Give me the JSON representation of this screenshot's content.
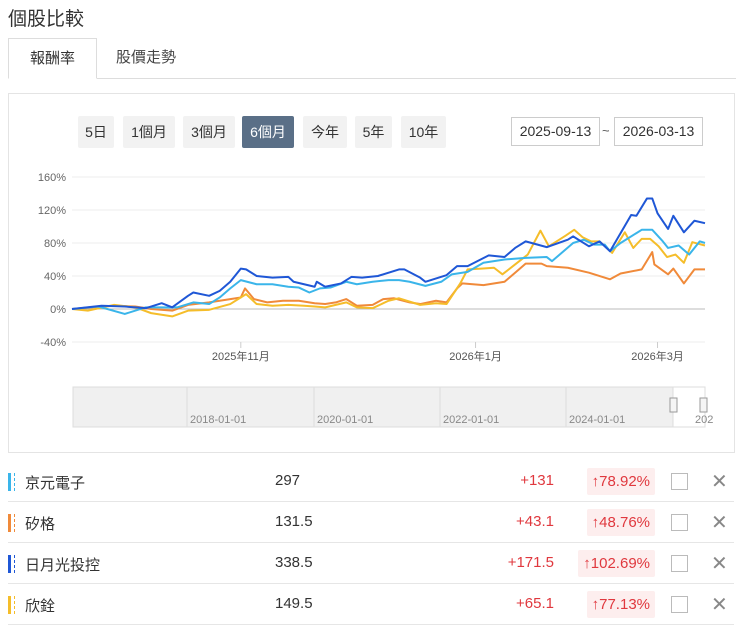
{
  "title": "個股比較",
  "tabs": [
    {
      "label": "報酬率",
      "active": true
    },
    {
      "label": "股價走勢",
      "active": false
    }
  ],
  "ranges": [
    {
      "label": "5日"
    },
    {
      "label": "1個月"
    },
    {
      "label": "3個月"
    },
    {
      "label": "6個月",
      "active": true
    },
    {
      "label": "今年"
    },
    {
      "label": "5年"
    },
    {
      "label": "10年"
    }
  ],
  "date_from": "2025-09-13",
  "date_sep": "~",
  "date_to": "2026-03-13",
  "navigator_labels": [
    "2018-01-01",
    "2020-01-01",
    "2022-01-01",
    "2024-01-01",
    "202"
  ],
  "stocks": [
    {
      "name": "京元電子",
      "price": "297",
      "change": "+131",
      "pct": "78.92%",
      "color": "#3ab5ea"
    },
    {
      "name": "矽格",
      "price": "131.5",
      "change": "+43.1",
      "pct": "48.76%",
      "color": "#f08a3a"
    },
    {
      "name": "日月光投控",
      "price": "338.5",
      "change": "+171.5",
      "pct": "102.69%",
      "color": "#1f57d6"
    },
    {
      "name": "欣銓",
      "price": "149.5",
      "change": "+65.1",
      "pct": "77.13%",
      "color": "#f5bd2a"
    }
  ],
  "chart_data": {
    "type": "line",
    "ylim": [
      -40,
      160
    ],
    "yticks": [
      -40,
      0,
      40,
      80,
      120,
      160
    ],
    "ytick_labels": [
      "-40%",
      "0%",
      "40%",
      "80%",
      "120%",
      "160%"
    ],
    "xlim": [
      0,
      120
    ],
    "xticks": [
      {
        "x": 32,
        "label": "2025年11月"
      },
      {
        "x": 76.5,
        "label": "2026年1月"
      },
      {
        "x": 111,
        "label": "2026年3月"
      }
    ],
    "series": [
      {
        "name": "京元電子",
        "color": "#3ab5ea",
        "points": [
          [
            0,
            0
          ],
          [
            5,
            3
          ],
          [
            10,
            -6
          ],
          [
            14,
            2
          ],
          [
            20,
            2
          ],
          [
            23,
            8
          ],
          [
            26,
            6
          ],
          [
            28,
            14
          ],
          [
            30,
            25
          ],
          [
            32,
            35
          ],
          [
            35,
            30
          ],
          [
            38,
            30
          ],
          [
            41,
            27
          ],
          [
            43,
            26
          ],
          [
            45,
            20
          ],
          [
            47,
            25
          ],
          [
            49,
            26
          ],
          [
            52,
            33
          ],
          [
            54,
            30
          ],
          [
            57,
            33
          ],
          [
            60,
            35
          ],
          [
            62,
            35
          ],
          [
            64,
            33
          ],
          [
            67,
            28
          ],
          [
            70,
            33
          ],
          [
            72,
            42
          ],
          [
            75,
            45
          ],
          [
            78,
            56
          ],
          [
            82,
            60
          ],
          [
            86,
            62
          ],
          [
            90,
            63
          ],
          [
            91,
            58
          ],
          [
            95,
            80
          ],
          [
            97,
            84
          ],
          [
            99,
            78
          ],
          [
            101,
            78
          ],
          [
            102,
            70
          ],
          [
            104,
            80
          ],
          [
            107,
            92
          ],
          [
            108,
            96
          ],
          [
            110,
            96
          ],
          [
            112,
            82
          ],
          [
            113,
            74
          ],
          [
            115,
            77
          ],
          [
            117,
            66
          ],
          [
            119,
            82
          ],
          [
            120,
            80
          ]
        ]
      },
      {
        "name": "矽格",
        "color": "#f08a3a",
        "points": [
          [
            0,
            0
          ],
          [
            8,
            4
          ],
          [
            12,
            3
          ],
          [
            15,
            0
          ],
          [
            19,
            -2
          ],
          [
            22,
            5
          ],
          [
            26,
            8
          ],
          [
            30,
            12
          ],
          [
            32,
            14
          ],
          [
            32.8,
            25
          ],
          [
            34.5,
            12
          ],
          [
            37,
            8
          ],
          [
            40,
            10
          ],
          [
            43,
            10
          ],
          [
            46,
            7
          ],
          [
            48,
            6
          ],
          [
            50,
            8
          ],
          [
            52,
            12
          ],
          [
            54,
            4
          ],
          [
            57,
            5
          ],
          [
            59,
            12
          ],
          [
            61,
            13
          ],
          [
            64,
            8
          ],
          [
            66,
            6
          ],
          [
            69,
            10
          ],
          [
            71,
            8
          ],
          [
            73,
            25
          ],
          [
            74,
            31
          ],
          [
            78,
            29
          ],
          [
            82,
            33
          ],
          [
            84,
            44
          ],
          [
            86,
            55
          ],
          [
            89,
            55
          ],
          [
            90,
            52
          ],
          [
            94,
            50
          ],
          [
            98,
            44
          ],
          [
            102,
            36
          ],
          [
            104,
            43
          ],
          [
            108,
            48
          ],
          [
            110,
            69
          ],
          [
            110.4,
            54
          ],
          [
            113,
            42
          ],
          [
            114,
            49
          ],
          [
            116,
            31
          ],
          [
            118,
            48
          ],
          [
            120,
            48
          ]
        ]
      },
      {
        "name": "日月光投控",
        "color": "#1f57d6",
        "points": [
          [
            0,
            0
          ],
          [
            5.6,
            4
          ],
          [
            10,
            3
          ],
          [
            14,
            1
          ],
          [
            17,
            7
          ],
          [
            19,
            2
          ],
          [
            22,
            16
          ],
          [
            23,
            20
          ],
          [
            26,
            16
          ],
          [
            28,
            22
          ],
          [
            30,
            33
          ],
          [
            32,
            49
          ],
          [
            33,
            48
          ],
          [
            35,
            40
          ],
          [
            38,
            38
          ],
          [
            41,
            39
          ],
          [
            42,
            33
          ],
          [
            46,
            27
          ],
          [
            46.4,
            33
          ],
          [
            48,
            27
          ],
          [
            51,
            31
          ],
          [
            53,
            39
          ],
          [
            55,
            38
          ],
          [
            58,
            40
          ],
          [
            62,
            48
          ],
          [
            63,
            48
          ],
          [
            66,
            38
          ],
          [
            67,
            33
          ],
          [
            70,
            39
          ],
          [
            71,
            41
          ],
          [
            73,
            52
          ],
          [
            75,
            52
          ],
          [
            79,
            65
          ],
          [
            82,
            63
          ],
          [
            84,
            74
          ],
          [
            86,
            82
          ],
          [
            90,
            75
          ],
          [
            94,
            84
          ],
          [
            95,
            88
          ],
          [
            98,
            76
          ],
          [
            100,
            82
          ],
          [
            102,
            70
          ],
          [
            106,
            114
          ],
          [
            107,
            113
          ],
          [
            109,
            134
          ],
          [
            110,
            134
          ],
          [
            111,
            116
          ],
          [
            113,
            97
          ],
          [
            114,
            113
          ],
          [
            116,
            93
          ],
          [
            118,
            107
          ],
          [
            120,
            104
          ]
        ]
      },
      {
        "name": "欣銓",
        "color": "#f5bd2a",
        "points": [
          [
            0,
            0
          ],
          [
            3,
            -2
          ],
          [
            8,
            5
          ],
          [
            12,
            2
          ],
          [
            15,
            -5
          ],
          [
            19,
            -9
          ],
          [
            22,
            -2
          ],
          [
            26,
            -1
          ],
          [
            30,
            6
          ],
          [
            33,
            18
          ],
          [
            35,
            6
          ],
          [
            38,
            4
          ],
          [
            41,
            5
          ],
          [
            44,
            4
          ],
          [
            46,
            3
          ],
          [
            48,
            2
          ],
          [
            52,
            8
          ],
          [
            54,
            2
          ],
          [
            57,
            1
          ],
          [
            60,
            10
          ],
          [
            62,
            13
          ],
          [
            66,
            5
          ],
          [
            69,
            7
          ],
          [
            71,
            6
          ],
          [
            73.6,
            31
          ],
          [
            75,
            48
          ],
          [
            77.6,
            49
          ],
          [
            80,
            50
          ],
          [
            81.6,
            42
          ],
          [
            84,
            54
          ],
          [
            86.4,
            66
          ],
          [
            88.8,
            95
          ],
          [
            90.4,
            76
          ],
          [
            93.6,
            89
          ],
          [
            95.2,
            96
          ],
          [
            96.8,
            87
          ],
          [
            98.4,
            82
          ],
          [
            100,
            82
          ],
          [
            102.4,
            68
          ],
          [
            104.8,
            93
          ],
          [
            106.4,
            74
          ],
          [
            108,
            85
          ],
          [
            109.6,
            85
          ],
          [
            111.2,
            76
          ],
          [
            112.8,
            63
          ],
          [
            114.4,
            66
          ],
          [
            116,
            56
          ],
          [
            117.6,
            81
          ],
          [
            120,
            77
          ]
        ]
      }
    ]
  }
}
